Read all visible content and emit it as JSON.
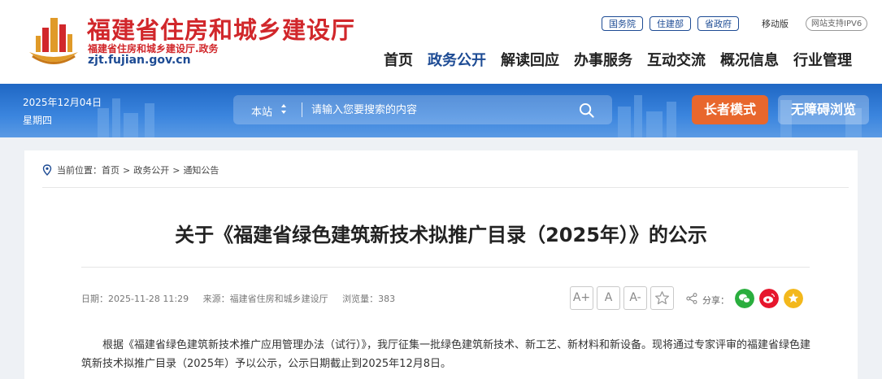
{
  "header": {
    "site_title": "福建省住房和城乡建设厅",
    "site_subtitle": "福建省住房和城乡建设厅.政务",
    "domain": "zjt.fujian.gov.cn",
    "top_links": [
      "国务院",
      "住建部",
      "省政府"
    ],
    "mobile": "移动版",
    "ipv6": "网站支持IPV6",
    "nav": [
      "首页",
      "政务公开",
      "解读回应",
      "办事服务",
      "互动交流",
      "概况信息",
      "行业管理"
    ],
    "active_nav": "政务公开"
  },
  "banner": {
    "date": "2025年12月04日",
    "weekday": "星期四",
    "search_scope": "本站",
    "search_placeholder": "请输入您要搜索的内容",
    "elder_mode": "长者模式",
    "accessible": "无障碍浏览"
  },
  "breadcrumb": {
    "prefix": "当前位置：",
    "items": [
      "首页",
      "政务公开",
      "通知公告"
    ],
    "separator": ">"
  },
  "article": {
    "title": "关于《福建省绿色建筑新技术拟推广目录（2025年）》的公示",
    "date": "日期：2025-11-28 11:29",
    "source": "来源：福建省住房和城乡建设厅",
    "views": "浏览量：383",
    "font_buttons": [
      "A+",
      "A",
      "A-"
    ],
    "share_label": "分享：",
    "body": "根据《福建省绿色建筑新技术推广应用管理办法（试行）》，我厅征集一批绿色建筑新技术、新工艺、新材料和新设备。现将通过专家评审的福建省绿色建筑新技术拟推广目录（2025年）予以公示，公示日期截止到2025年12月8日。"
  },
  "colors": {
    "brand_red": "#d1272b",
    "brand_blue": "#1d4b94",
    "elder_orange": "#e8672d",
    "wechat_green": "#2aae3e",
    "weibo_red": "#e6162d",
    "fav_yellow": "#f3b81c"
  }
}
